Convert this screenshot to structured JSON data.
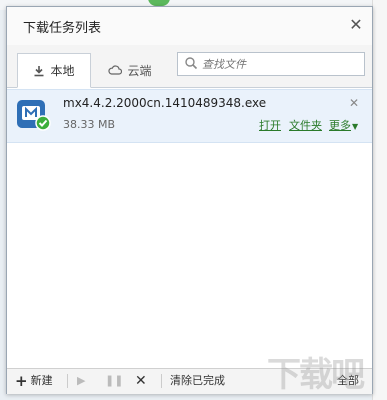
{
  "window": {
    "title": "下载任务列表"
  },
  "tabs": [
    {
      "label": "本地",
      "icon": "download-icon",
      "active": true
    },
    {
      "label": "云端",
      "icon": "cloud-icon",
      "active": false
    }
  ],
  "search": {
    "placeholder": "查找文件"
  },
  "downloads": [
    {
      "filename": "mx4.4.2.2000cn.1410489348.exe",
      "size": "38.33 MB",
      "actions": {
        "open": "打开",
        "folder": "文件夹",
        "more": "更多"
      }
    }
  ],
  "toolbar": {
    "new_label": "新建",
    "clear_label": "清除已完成",
    "all_label": "全部"
  },
  "watermark": "下载吧",
  "colors": {
    "accent_green": "#2a7a2a",
    "row_highlight": "#eaf2fb",
    "app_blue": "#2f6fb6"
  }
}
